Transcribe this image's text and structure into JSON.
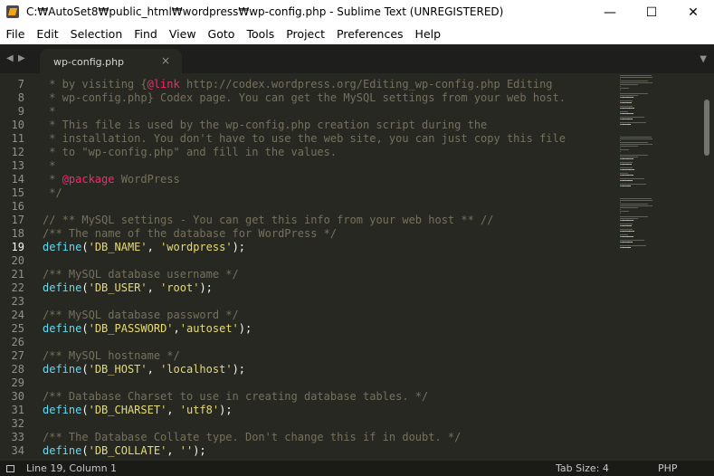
{
  "window": {
    "title": "C:₩AutoSet8₩public_html₩wordpress₩wp-config.php - Sublime Text (UNREGISTERED)",
    "minimize_glyph": "—",
    "maximize_glyph": "☐",
    "close_glyph": "✕"
  },
  "menu": [
    "File",
    "Edit",
    "Selection",
    "Find",
    "View",
    "Goto",
    "Tools",
    "Project",
    "Preferences",
    "Help"
  ],
  "tabs": {
    "left_arrow": "◀",
    "right_arrow": "▶",
    "active_tab": "wp-config.php",
    "close_glyph": "×",
    "dropdown": "▼"
  },
  "editor": {
    "active_line": 19,
    "lines": [
      {
        "n": 7,
        "tokens": [
          {
            "t": " * by visiting {",
            "c": "c"
          },
          {
            "t": "@link",
            "c": "kw"
          },
          {
            "t": " http://codex.wordpress.org/Editing_wp-config.php Editing",
            "c": "c"
          }
        ]
      },
      {
        "n": 8,
        "tokens": [
          {
            "t": " * wp-config.php} Codex page. You can get the MySQL settings from your web host.",
            "c": "c"
          }
        ]
      },
      {
        "n": 9,
        "tokens": [
          {
            "t": " *",
            "c": "c"
          }
        ]
      },
      {
        "n": 10,
        "tokens": [
          {
            "t": " * This file is used by the wp-config.php creation script during the",
            "c": "c"
          }
        ]
      },
      {
        "n": 11,
        "tokens": [
          {
            "t": " * installation. You don't have to use the web site, you can just copy this file",
            "c": "c"
          }
        ]
      },
      {
        "n": 12,
        "tokens": [
          {
            "t": " * to \"wp-config.php\" and fill in the values.",
            "c": "c"
          }
        ]
      },
      {
        "n": 13,
        "tokens": [
          {
            "t": " *",
            "c": "c"
          }
        ]
      },
      {
        "n": 14,
        "tokens": [
          {
            "t": " * ",
            "c": "c"
          },
          {
            "t": "@package",
            "c": "kw"
          },
          {
            "t": " WordPress",
            "c": "c"
          }
        ]
      },
      {
        "n": 15,
        "tokens": [
          {
            "t": " */",
            "c": "c"
          }
        ]
      },
      {
        "n": 16,
        "tokens": []
      },
      {
        "n": 17,
        "tokens": [
          {
            "t": "// ** MySQL settings - You can get this info from your web host ** //",
            "c": "c"
          }
        ]
      },
      {
        "n": 18,
        "tokens": [
          {
            "t": "/** The name of the database for WordPress */",
            "c": "c"
          }
        ]
      },
      {
        "n": 19,
        "tokens": [
          {
            "t": "define",
            "c": "fn"
          },
          {
            "t": "(",
            "c": "pn"
          },
          {
            "t": "'DB_NAME'",
            "c": "str"
          },
          {
            "t": ", ",
            "c": "pn"
          },
          {
            "t": "'wordpress'",
            "c": "str"
          },
          {
            "t": ");",
            "c": "pn"
          }
        ]
      },
      {
        "n": 20,
        "tokens": []
      },
      {
        "n": 21,
        "tokens": [
          {
            "t": "/** MySQL database username */",
            "c": "c"
          }
        ]
      },
      {
        "n": 22,
        "tokens": [
          {
            "t": "define",
            "c": "fn"
          },
          {
            "t": "(",
            "c": "pn"
          },
          {
            "t": "'DB_USER'",
            "c": "str"
          },
          {
            "t": ", ",
            "c": "pn"
          },
          {
            "t": "'root'",
            "c": "str"
          },
          {
            "t": ");",
            "c": "pn"
          }
        ]
      },
      {
        "n": 23,
        "tokens": []
      },
      {
        "n": 24,
        "tokens": [
          {
            "t": "/** MySQL database password */",
            "c": "c"
          }
        ]
      },
      {
        "n": 25,
        "tokens": [
          {
            "t": "define",
            "c": "fn"
          },
          {
            "t": "(",
            "c": "pn"
          },
          {
            "t": "'DB_PASSWORD'",
            "c": "str"
          },
          {
            "t": ",",
            "c": "pn"
          },
          {
            "t": "'autoset'",
            "c": "str"
          },
          {
            "t": ");",
            "c": "pn"
          }
        ]
      },
      {
        "n": 26,
        "tokens": []
      },
      {
        "n": 27,
        "tokens": [
          {
            "t": "/** MySQL hostname */",
            "c": "c"
          }
        ]
      },
      {
        "n": 28,
        "tokens": [
          {
            "t": "define",
            "c": "fn"
          },
          {
            "t": "(",
            "c": "pn"
          },
          {
            "t": "'DB_HOST'",
            "c": "str"
          },
          {
            "t": ", ",
            "c": "pn"
          },
          {
            "t": "'localhost'",
            "c": "str"
          },
          {
            "t": ");",
            "c": "pn"
          }
        ]
      },
      {
        "n": 29,
        "tokens": []
      },
      {
        "n": 30,
        "tokens": [
          {
            "t": "/** Database Charset to use in creating database tables. */",
            "c": "c"
          }
        ]
      },
      {
        "n": 31,
        "tokens": [
          {
            "t": "define",
            "c": "fn"
          },
          {
            "t": "(",
            "c": "pn"
          },
          {
            "t": "'DB_CHARSET'",
            "c": "str"
          },
          {
            "t": ", ",
            "c": "pn"
          },
          {
            "t": "'utf8'",
            "c": "str"
          },
          {
            "t": ");",
            "c": "pn"
          }
        ]
      },
      {
        "n": 32,
        "tokens": []
      },
      {
        "n": 33,
        "tokens": [
          {
            "t": "/** The Database Collate type. Don't change this if in doubt. */",
            "c": "c"
          }
        ]
      },
      {
        "n": 34,
        "tokens": [
          {
            "t": "define",
            "c": "fn"
          },
          {
            "t": "(",
            "c": "pn"
          },
          {
            "t": "'DB_COLLATE'",
            "c": "str"
          },
          {
            "t": ", ",
            "c": "pn"
          },
          {
            "t": "''",
            "c": "str"
          },
          {
            "t": ");",
            "c": "pn"
          }
        ]
      }
    ]
  },
  "colors": {
    "comment": "#75715e",
    "keyword": "#f92672",
    "function": "#66d9ef",
    "string": "#e6db74",
    "plain": "#f8f8f2",
    "background": "#272822"
  },
  "status": {
    "position": "Line 19, Column 1",
    "tab_size": "Tab Size: 4",
    "syntax": "PHP"
  }
}
